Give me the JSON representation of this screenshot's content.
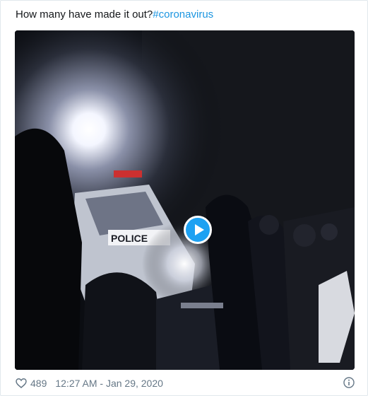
{
  "tweet": {
    "text": "How many have made it out?",
    "hashtag": "#coronavirus"
  },
  "media": {
    "type": "video",
    "overlay_text": "POLICE",
    "play_icon": "play-icon",
    "accent_color": "#1da1f2"
  },
  "footer": {
    "like_icon": "heart-icon",
    "likes": "489",
    "timestamp": "12:27 AM - Jan 29, 2020",
    "info_icon": "info-icon"
  },
  "colors": {
    "text": "#14171a",
    "hashtag": "#1b95e0",
    "meta": "#657786",
    "border": "#e1e8ed"
  }
}
